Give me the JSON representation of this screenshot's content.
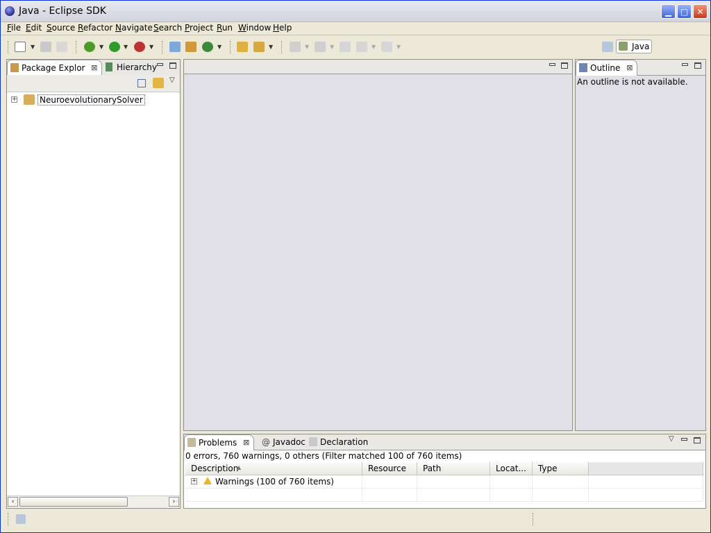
{
  "window": {
    "title": "Java - Eclipse SDK"
  },
  "menu": [
    "File",
    "Edit",
    "Source",
    "Refactor",
    "Navigate",
    "Search",
    "Project",
    "Run",
    "Window",
    "Help"
  ],
  "perspective": {
    "label": "Java"
  },
  "package_explorer": {
    "tabs": [
      {
        "label": "Package Explor",
        "close": "⊠"
      },
      {
        "label": "Hierarchy"
      }
    ],
    "tree": [
      {
        "label": "NeuroevolutionarySolver",
        "expander": "+"
      }
    ],
    "scroll": {
      "left": "‹",
      "right": "›"
    }
  },
  "outline": {
    "tab": {
      "label": "Outline",
      "close": "⊠"
    },
    "message": "An outline is not available."
  },
  "problems": {
    "tabs": [
      {
        "label": "Problems",
        "close": "⊠"
      },
      {
        "label": "Javadoc",
        "icon_glyph": "@"
      },
      {
        "label": "Declaration"
      }
    ],
    "summary": "0 errors, 760 warnings, 0 others (Filter matched 100 of 760 items)",
    "columns": [
      "Description",
      "Resource",
      "Path",
      "Locat...",
      "Type"
    ],
    "rows": [
      {
        "expander": "+",
        "label": "Warnings (100 of 760 items)"
      }
    ]
  },
  "colors": {
    "accent": "#3a6ea5",
    "chrome": "#ece9d8",
    "editor_area": "#e1e0e6"
  }
}
